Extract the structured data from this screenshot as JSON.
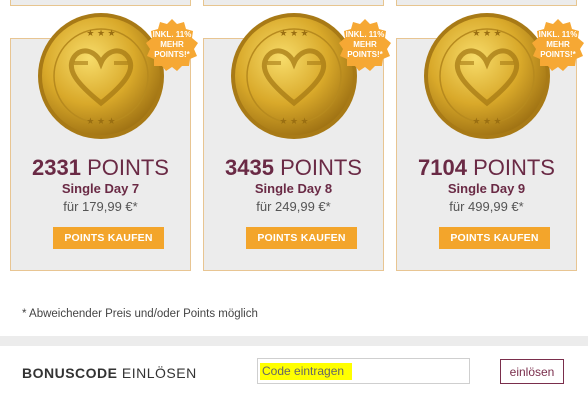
{
  "colors": {
    "accent": "#f3a52b",
    "brand": "#6a2a45",
    "card_bg": "#ececec",
    "card_border": "#e8c592",
    "highlight": "#ffff00"
  },
  "offers": [
    {
      "badge": "INKL. 11%\nMEHR\nPOINTS!*",
      "points_number": "2331",
      "points_label": "POINTS",
      "package": "Single Day 7",
      "price": "für 179,99 €*",
      "button": "POINTS KAUFEN",
      "icon": "gold-coin-icon"
    },
    {
      "badge": "INKL. 11%\nMEHR\nPOINTS!*",
      "points_number": "3435",
      "points_label": "POINTS",
      "package": "Single Day 8",
      "price": "für 249,99 €*",
      "button": "POINTS KAUFEN",
      "icon": "gold-coin-icon"
    },
    {
      "badge": "INKL. 11%\nMEHR\nPOINTS!*",
      "points_number": "7104",
      "points_label": "POINTS",
      "package": "Single Day 9",
      "price": "für 499,99 €*",
      "button": "POINTS KAUFEN",
      "icon": "gold-coin-icon"
    }
  ],
  "footnote": "* Abweichender Preis und/oder Points möglich",
  "bonus": {
    "title_bold": "BONUSCODE",
    "title_rest": "EINLÖSEN",
    "placeholder": "Code eintragen",
    "value": "",
    "button": "einlösen"
  }
}
